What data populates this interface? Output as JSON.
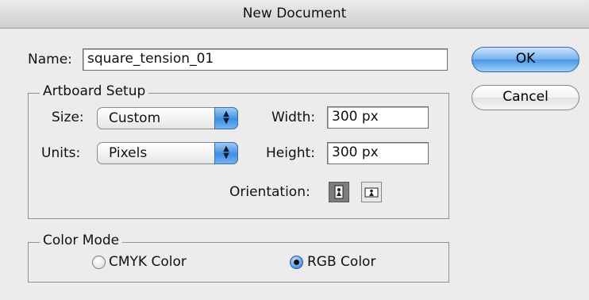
{
  "window": {
    "title": "New Document"
  },
  "name_field": {
    "label": "Name:",
    "value": "square_tension_01"
  },
  "artboard": {
    "legend": "Artboard Setup",
    "size": {
      "label": "Size:",
      "value": "Custom"
    },
    "units": {
      "label": "Units:",
      "value": "Pixels"
    },
    "width": {
      "label": "Width:",
      "value": "300 px"
    },
    "height": {
      "label": "Height:",
      "value": "300 px"
    },
    "orientation": {
      "label": "Orientation:",
      "selected": "portrait"
    }
  },
  "color_mode": {
    "legend": "Color Mode",
    "options": [
      {
        "label": "CMYK Color",
        "selected": false
      },
      {
        "label": "RGB Color",
        "selected": true
      }
    ]
  },
  "buttons": {
    "ok": "OK",
    "cancel": "Cancel"
  },
  "icons": {
    "popup_arrows": "up-down-arrows-icon",
    "portrait": "portrait-orientation-icon",
    "landscape": "landscape-orientation-icon"
  }
}
